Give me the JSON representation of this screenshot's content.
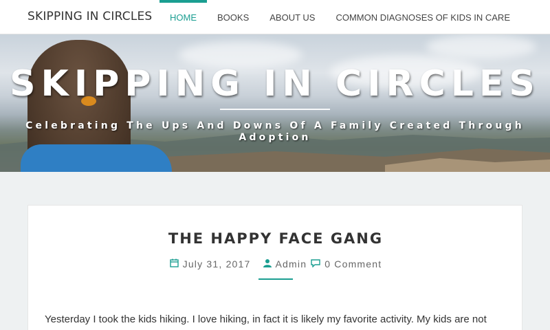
{
  "site": {
    "brand": "SKIPPING IN CIRCLES",
    "nav": [
      {
        "label": "HOME",
        "active": true
      },
      {
        "label": "BOOKS",
        "active": false
      },
      {
        "label": "ABOUT US",
        "active": false
      },
      {
        "label": "COMMON DIAGNOSES OF KIDS IN CARE",
        "active": false
      }
    ],
    "accent_color": "#1a9e91"
  },
  "hero": {
    "title": "SKIPPING IN CIRCLES",
    "tagline": "Celebrating The Ups And Downs Of A Family Created Through Adoption"
  },
  "post": {
    "title": "THE HAPPY FACE GANG",
    "date": "July 31, 2017",
    "author": "Admin",
    "comments": "0 Comment",
    "icons": [
      "calendar-icon",
      "user-icon",
      "comments-icon"
    ],
    "excerpt": "Yesterday I took the kids hiking. I love hiking, in fact it is likely my favorite activity. My kids are not"
  }
}
